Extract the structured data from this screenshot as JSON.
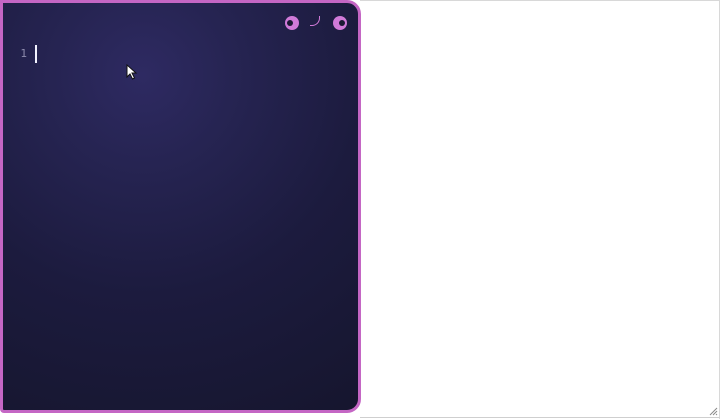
{
  "editor": {
    "line_numbers": [
      "1"
    ],
    "lines": [
      ""
    ]
  },
  "window_controls": {
    "left_icon": "eye-icon",
    "middle_icon": "mouth-icon",
    "right_icon": "eye-icon"
  },
  "colors": {
    "accent": "#c466c4",
    "editor_background": "#1c1b3e",
    "line_number": "#8e8cad",
    "caret": "#f2f2ff"
  }
}
